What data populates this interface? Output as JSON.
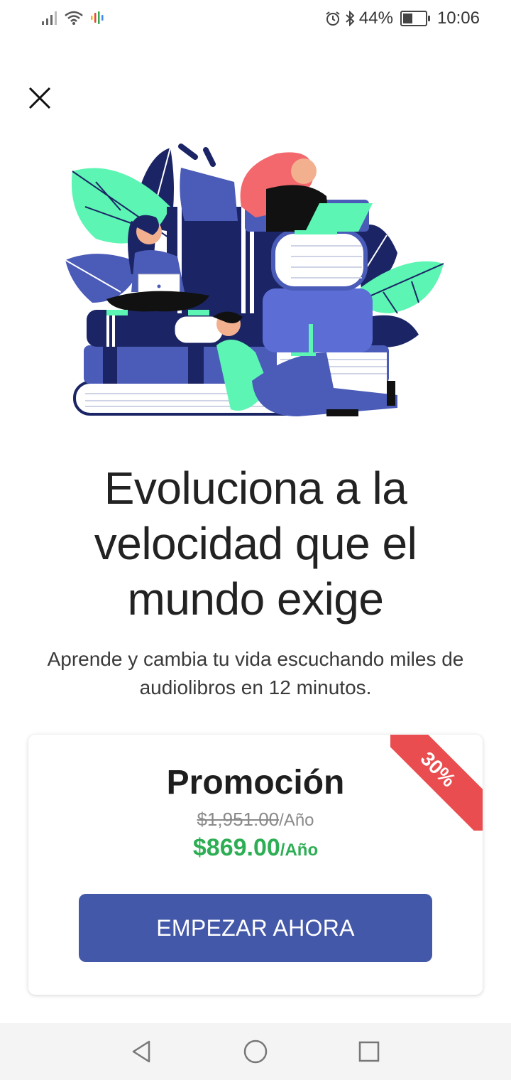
{
  "status_bar": {
    "battery_percent": "44%",
    "battery_level": 0.44,
    "time": "10:06"
  },
  "hero": {
    "headline_lines": [
      "Evoluciona a la",
      "velocidad que el",
      "mundo exige"
    ],
    "subhead": "Aprende y cambia tu vida escuchando miles de audiolibros en 12 minutos."
  },
  "promo": {
    "badge": "30%",
    "title": "Promoción",
    "old_price": "$1,951.00",
    "old_price_period": "/Año",
    "new_price": "$869.00",
    "new_price_period": "/Año",
    "cta_label": "EMPEZAR AHORA"
  },
  "colors": {
    "accent": "#4458a9",
    "price_green": "#2eae54",
    "ribbon_red": "#ea4d4f",
    "leaf_green": "#5cf5b3",
    "navy": "#1b2565"
  },
  "icons": {
    "close": "close-icon",
    "nav_back": "back-triangle-icon",
    "nav_home": "home-circle-icon",
    "nav_recents": "recents-square-icon"
  }
}
